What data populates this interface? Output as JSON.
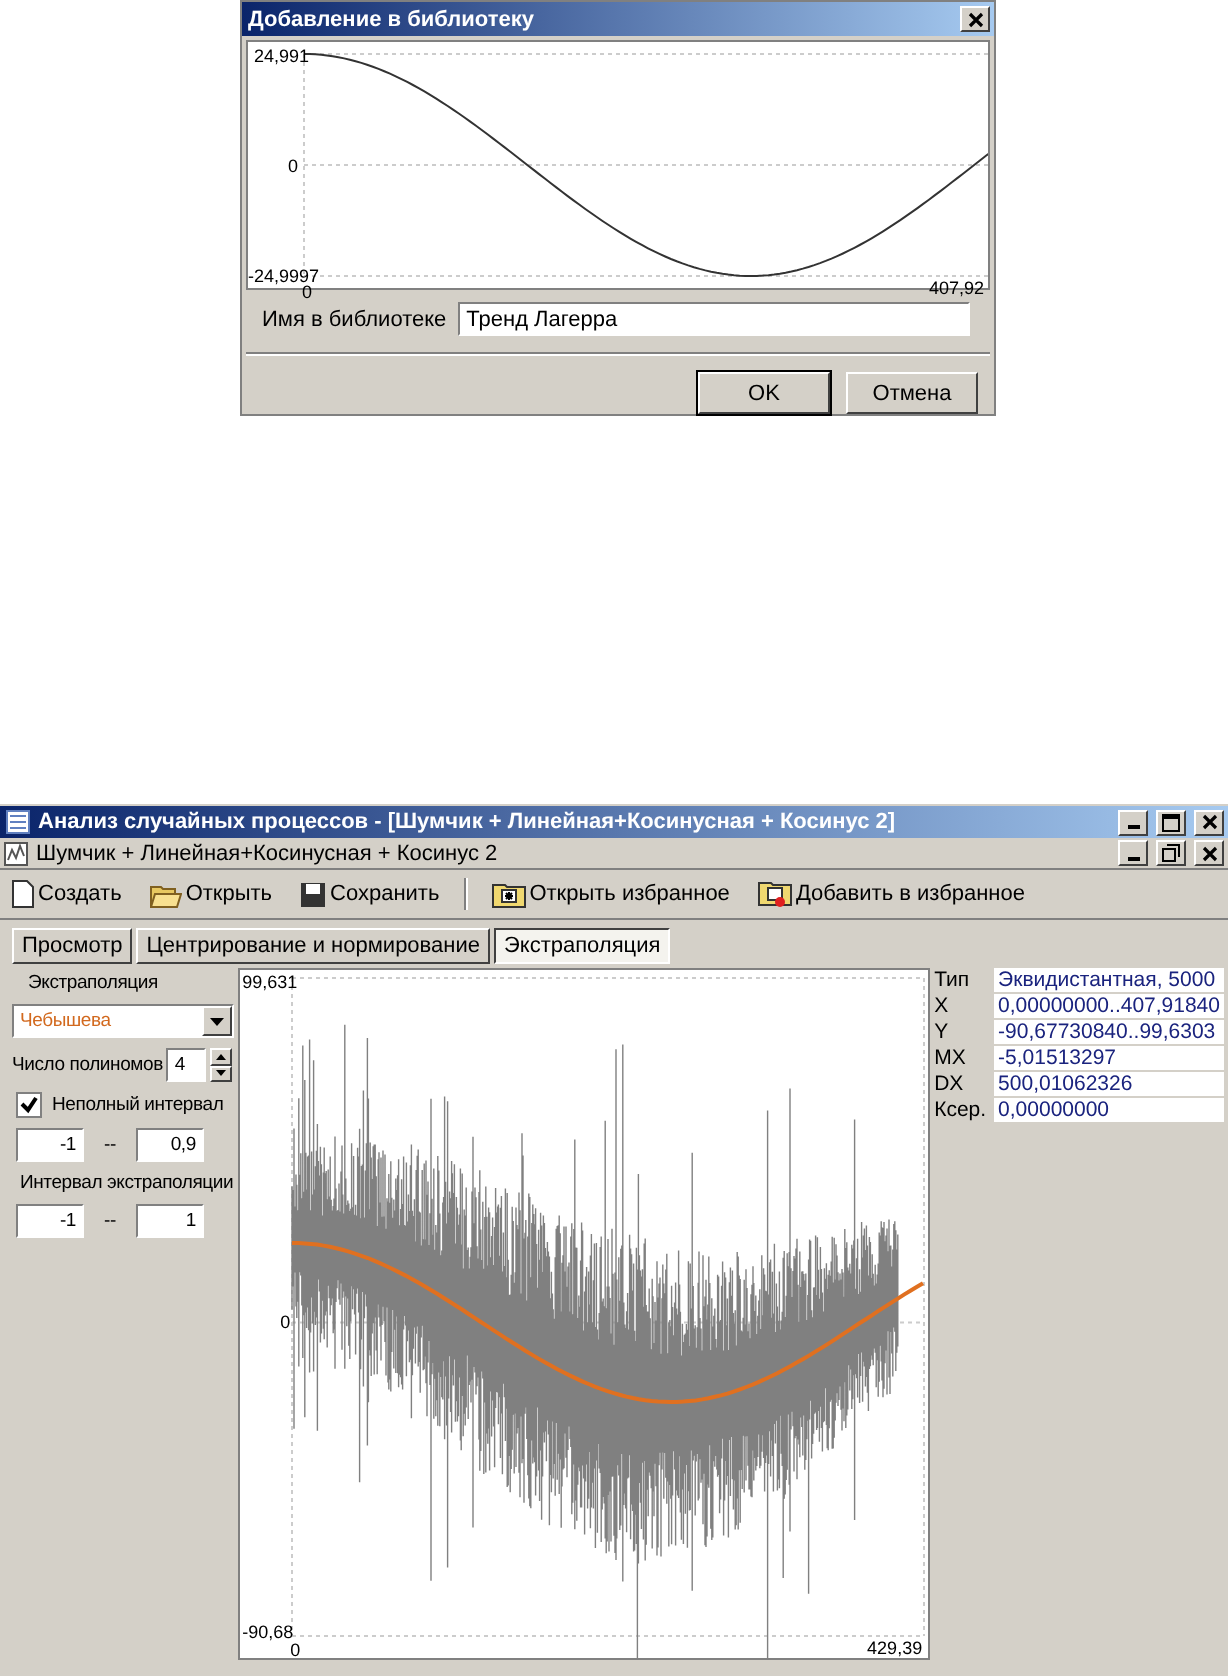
{
  "dialog": {
    "title": "Добавление в библиотеку",
    "chart": {
      "y_max": "24,991",
      "y_zero": "0",
      "y_min": "-24,9997",
      "x_min": "0",
      "x_max": "407,92"
    },
    "name_label": "Имя в библиотеке",
    "name_value": "Тренд Лагерра",
    "buttons": [
      {
        "label": "OK",
        "default": true
      },
      {
        "label": "Отмена",
        "default": false
      }
    ]
  },
  "main": {
    "title": "Анализ случайных процессов - [Шумчик + Линейная+Косинусная + Косинус 2]",
    "document_title": "Шумчик + Линейная+Косинусная + Косинус 2",
    "toolbar": [
      {
        "kind": "new",
        "label": "Создать",
        "divider_before": false
      },
      {
        "kind": "open",
        "label": "Открыть",
        "divider_before": false
      },
      {
        "kind": "save",
        "label": "Сохранить",
        "divider_before": false
      },
      {
        "kind": "open-favorites",
        "label": "Открыть избранное",
        "divider_before": true
      },
      {
        "kind": "add-favorites",
        "label": "Добавить в избранное",
        "divider_before": false
      }
    ],
    "tabs": [
      {
        "label": "Просмотр",
        "selected": false
      },
      {
        "label": "Центрирование и нормирование",
        "selected": false
      },
      {
        "label": "Экстраполяция",
        "selected": true
      }
    ],
    "method_label": "Экстраполяция",
    "method": "Чебышева",
    "polynomials_label": "Число полиномов",
    "polynomials": "4",
    "partial": {
      "label": "Неполный интервал",
      "checked": true,
      "from": "-1",
      "separator": "--",
      "to": "0,9"
    },
    "extrapolation": {
      "label": "Интервал экстраполяции",
      "from": "-1",
      "separator": "--",
      "to": "1"
    },
    "chart": {
      "y_max": "99,631",
      "y_zero": "0",
      "y_min": "-90,68",
      "x_min": "0",
      "x_max": "429,39"
    },
    "info": [
      {
        "label": "Тип",
        "value": "Эквидистантная, 5000"
      },
      {
        "label": "X",
        "value": "0,00000000..407,91840"
      },
      {
        "label": "Y",
        "value": "-90,67730840..99,6303"
      },
      {
        "label": "MX",
        "value": "-5,01513297"
      },
      {
        "label": "DX",
        "value": "500,01062326"
      },
      {
        "label": "Ксер.",
        "value": "0,00000000"
      }
    ]
  }
}
